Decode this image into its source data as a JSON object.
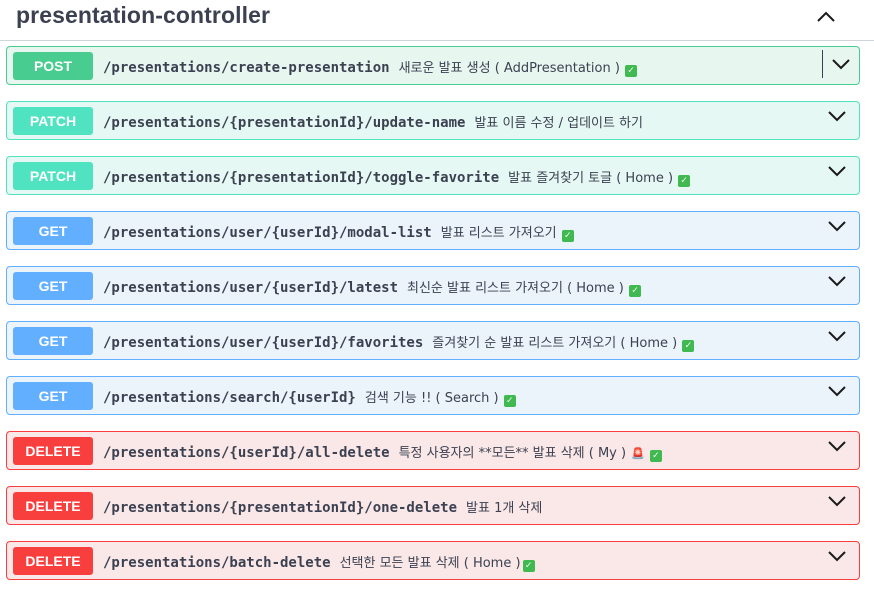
{
  "controller": {
    "title": "presentation-controller"
  },
  "operations": [
    {
      "method": "POST",
      "path": "/presentations/create-presentation",
      "summary": "새로운 발표 생성 ( AddPresentation )",
      "check": "✓"
    },
    {
      "method": "PATCH",
      "path": "/presentations/{presentationId}/update-name",
      "summary": "발표 이름 수정 / 업데이트 하기"
    },
    {
      "method": "PATCH",
      "path": "/presentations/{presentationId}/toggle-favorite",
      "summary": "발표 즐겨찾기 토글 ( Home )",
      "check": "✓"
    },
    {
      "method": "GET",
      "path": "/presentations/user/{userId}/modal-list",
      "summary": "발표 리스트 가져오기",
      "check": "✓"
    },
    {
      "method": "GET",
      "path": "/presentations/user/{userId}/latest",
      "summary": "최신순 발표 리스트 가져오기 ( Home )",
      "check": "✓"
    },
    {
      "method": "GET",
      "path": "/presentations/user/{userId}/favorites",
      "summary": "즐겨찾기 순 발표 리스트 가져오기 ( Home )",
      "check": "✓"
    },
    {
      "method": "GET",
      "path": "/presentations/search/{userId}",
      "summary": "검색 기능 !! ( Search )",
      "check": "✓"
    },
    {
      "method": "DELETE",
      "path": "/presentations/{userId}/all-delete",
      "summary": "특정 사용자의 **모든** 발표 삭제 ( My )",
      "warn": "🚨",
      "check": "✓"
    },
    {
      "method": "DELETE",
      "path": "/presentations/{presentationId}/one-delete",
      "summary": "발표 1개 삭제"
    },
    {
      "method": "DELETE",
      "path": "/presentations/batch-delete",
      "summary": "선택한 모든 발표 삭제 ( Home )",
      "check": "✓"
    }
  ],
  "colors": {
    "post": "#49cc90",
    "patch": "#50e3c2",
    "get": "#61affe",
    "delete": "#f93e3e",
    "text": "#3b4151"
  },
  "icons": {
    "collapse": "chevron-up-icon",
    "expand": "chevron-down-icon",
    "check": "check-box-icon",
    "warn": "siren-icon"
  }
}
